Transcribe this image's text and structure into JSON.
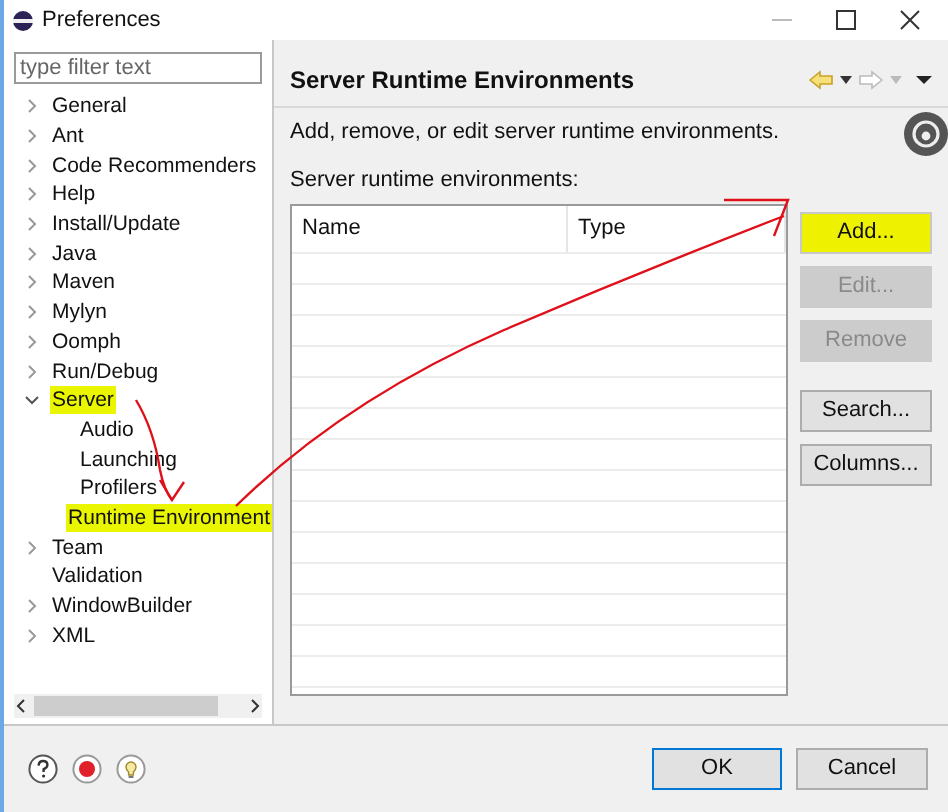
{
  "window": {
    "title": "Preferences"
  },
  "filter": {
    "placeholder": "type filter text"
  },
  "tree": [
    {
      "label": "General",
      "expanded": false,
      "highlighted": false
    },
    {
      "label": "Ant",
      "expanded": false,
      "highlighted": false
    },
    {
      "label": "Code Recommenders",
      "expanded": false,
      "highlighted": false
    },
    {
      "label": "Help",
      "expanded": false,
      "highlighted": false
    },
    {
      "label": "Install/Update",
      "expanded": false,
      "highlighted": false
    },
    {
      "label": "Java",
      "expanded": false,
      "highlighted": false
    },
    {
      "label": "Maven",
      "expanded": false,
      "highlighted": false
    },
    {
      "label": "Mylyn",
      "expanded": false,
      "highlighted": false
    },
    {
      "label": "Oomph",
      "expanded": false,
      "highlighted": false
    },
    {
      "label": "Run/Debug",
      "expanded": false,
      "highlighted": false
    },
    {
      "label": "Server",
      "expanded": true,
      "highlighted": true,
      "children": [
        {
          "label": "Audio",
          "highlighted": false
        },
        {
          "label": "Launching",
          "highlighted": false
        },
        {
          "label": "Profilers",
          "highlighted": false
        },
        {
          "label": "Runtime Environment",
          "highlighted": true
        }
      ]
    },
    {
      "label": "Team",
      "expanded": false,
      "highlighted": false
    },
    {
      "label": "Validation",
      "highlighted": false
    },
    {
      "label": "WindowBuilder",
      "expanded": false,
      "highlighted": false
    },
    {
      "label": "XML",
      "expanded": false,
      "highlighted": false
    }
  ],
  "page": {
    "title": "Server Runtime Environments",
    "description": "Add, remove, or edit server runtime environments.",
    "table_label": "Server runtime environments:"
  },
  "table": {
    "columns": [
      "Name",
      "Type"
    ]
  },
  "side_button_groups": [
    [
      {
        "label": "Add...",
        "disabled": false,
        "highlighted": true
      },
      {
        "label": "Edit...",
        "disabled": true,
        "highlighted": false
      },
      {
        "label": "Remove",
        "disabled": true,
        "highlighted": false
      }
    ],
    [
      {
        "label": "Search...",
        "disabled": false,
        "highlighted": false
      },
      {
        "label": "Columns...",
        "disabled": false,
        "highlighted": false
      }
    ]
  ],
  "footer_buttons": [
    {
      "label": "OK",
      "default": true
    },
    {
      "label": "Cancel",
      "default": false
    }
  ]
}
